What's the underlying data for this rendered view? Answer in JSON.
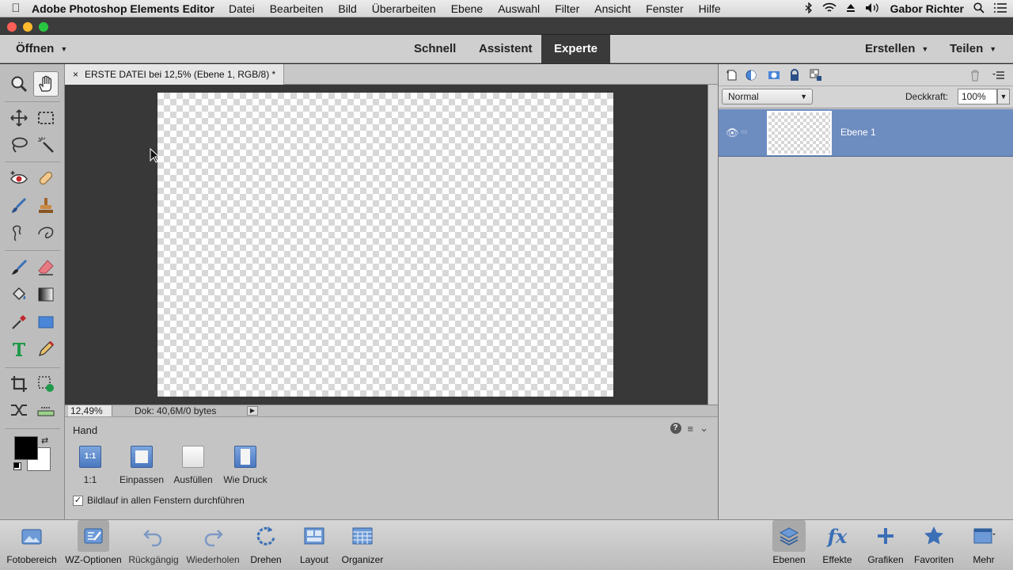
{
  "menubar": {
    "app_name": "Adobe Photoshop Elements Editor",
    "menus": [
      "Datei",
      "Bearbeiten",
      "Bild",
      "Überarbeiten",
      "Ebene",
      "Auswahl",
      "Filter",
      "Ansicht",
      "Fenster",
      "Hilfe"
    ],
    "user": "Gabor Richter"
  },
  "modebar": {
    "open_label": "Öffnen",
    "tabs": [
      "Schnell",
      "Assistent",
      "Experte"
    ],
    "active_tab": "Experte",
    "create_label": "Erstellen",
    "share_label": "Teilen"
  },
  "document": {
    "tab_title": "ERSTE DATEI bei 12,5% (Ebene 1, RGB/8) *",
    "zoom": "12,49%",
    "info": "Dok: 40,6M/0 bytes"
  },
  "options": {
    "tool_name": "Hand",
    "buttons": [
      "1:1",
      "Einpassen",
      "Ausfüllen",
      "Wie Druck"
    ],
    "button_1_icon_text": "1:1",
    "checkbox_label": "Bildlauf in allen Fenstern durchführen",
    "checkbox_checked": true
  },
  "layers": {
    "blend_mode": "Normal",
    "opacity_label": "Deckkraft:",
    "opacity_value": "100%",
    "items": [
      {
        "name": "Ebene 1",
        "visible": true,
        "selected": true
      }
    ]
  },
  "taskbar": {
    "left": [
      "Fotobereich",
      "WZ-Optionen",
      "Rückgängig",
      "Wiederholen",
      "Drehen",
      "Layout",
      "Organizer"
    ],
    "right": [
      "Ebenen",
      "Effekte",
      "Grafiken",
      "Favoriten",
      "Mehr"
    ]
  },
  "colors": {
    "accent_blue": "#6d8cc0",
    "foreground_color": "#000000",
    "background_color": "#ffffff"
  }
}
